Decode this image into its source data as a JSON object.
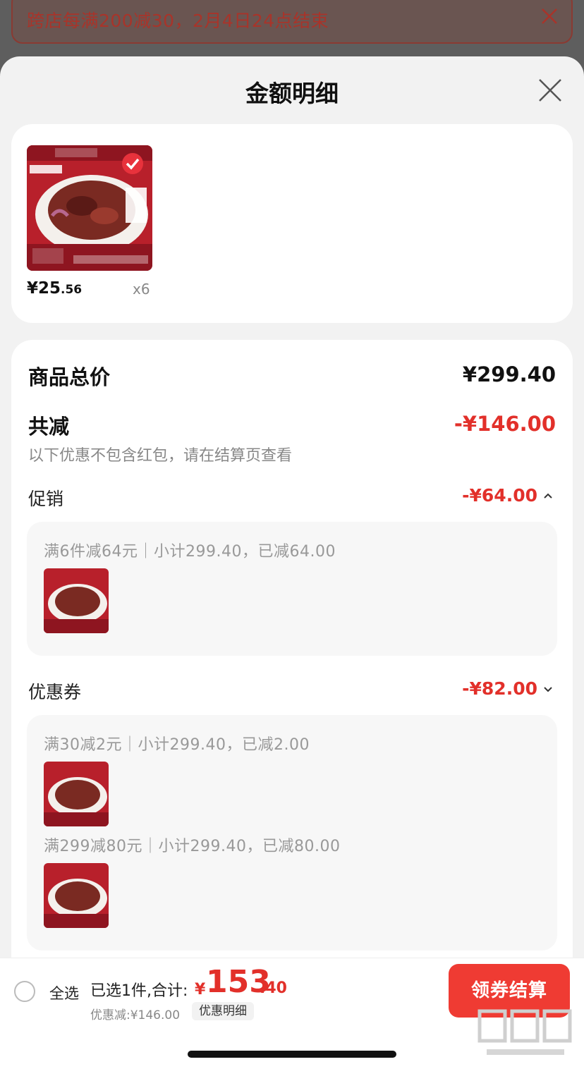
{
  "promo": {
    "text": "跨店每满200减30，2月4日24点结束"
  },
  "sheet": {
    "title": "金额明细"
  },
  "product": {
    "price_int": "¥25",
    "price_dec": ".56",
    "quantity": "x6"
  },
  "summary": {
    "goods_total_label": "商品总价",
    "goods_total_value": "¥299.40",
    "total_discount_label": "共减",
    "total_discount_value": "-¥146.00",
    "note": "以下优惠不包含红包，请在结算页查看"
  },
  "promotion": {
    "label": "促销",
    "value": "-¥64.00",
    "rule": "满6件减64元｜小计299.40，已减64.00"
  },
  "coupons": {
    "label": "优惠券",
    "value": "-¥82.00",
    "rules": [
      "满30减2元｜小计299.40，已减2.00",
      "满299减80元｜小计299.40，已减80.00"
    ]
  },
  "checkout": {
    "select_all": "全选",
    "selected_text": "已选1件,合计:",
    "total_yen": "¥",
    "total_int": "153",
    "total_dec": ".40",
    "discount_text": "优惠减:¥146.00",
    "detail_link": "优惠明细",
    "button": "领券结算"
  },
  "colors": {
    "accent_red": "#e2302a",
    "button_red": "#ef3b33"
  }
}
